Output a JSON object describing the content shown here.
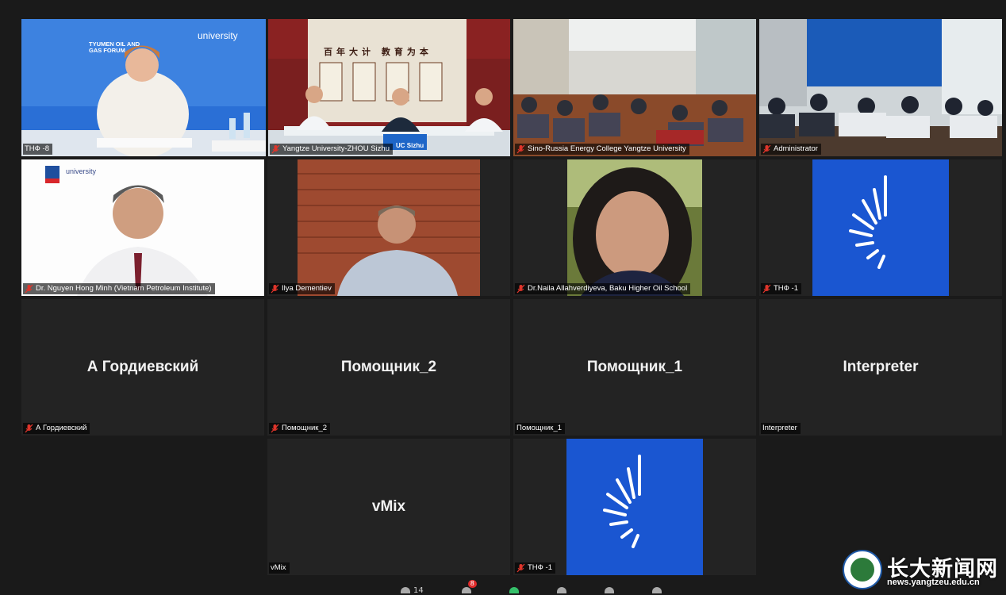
{
  "tiles": [
    {
      "label": "ТНФ -8",
      "muted": false
    },
    {
      "label": "Yangtze University-ZHOU Sizhu",
      "muted": true
    },
    {
      "label": "Sino-Russia Energy College Yangtze University",
      "muted": true
    },
    {
      "label": "Administrator",
      "muted": true
    },
    {
      "label": "Dr. Nguyen Hong Minh (Vietnam Petroleum Institute)",
      "muted": true
    },
    {
      "label": "Ilya Dementiev",
      "muted": true
    },
    {
      "label": "Dr.Naila Allahverdiyeva, Baku Higher Oil School",
      "muted": true
    },
    {
      "label": "ТНФ -1",
      "muted": true
    },
    {
      "label": "А Гордиевский",
      "center": "А Гордиевский",
      "muted": true
    },
    {
      "label": "Помощник_2",
      "center": "Помощник_2",
      "muted": true
    },
    {
      "label": "Помощник_1",
      "center": "Помощник_1",
      "muted": false
    },
    {
      "label": "Interpreter",
      "center": "Interpreter",
      "muted": false
    },
    {
      "label": "vMix",
      "center": "vMix",
      "muted": false
    },
    {
      "label": "ТНФ -1",
      "muted": true
    }
  ],
  "scene": {
    "tile1_banner": "TYUMEN OIL AND GAS FORUM",
    "tile1_univ": "university",
    "tile2_sign": "百年大计 教育为本",
    "tile2_placard": "UC Sizhu",
    "tile5_univ": "university"
  },
  "toolbar": {
    "participants": "14",
    "chat_badge": "8"
  },
  "watermark": {
    "title": "长大新闻网",
    "url": "news.yangtzeu.edu.cn"
  },
  "colors": {
    "active_speaker": "#b7e36a",
    "brand_blue": "#1a56d1",
    "mute_red": "#e0352b"
  }
}
